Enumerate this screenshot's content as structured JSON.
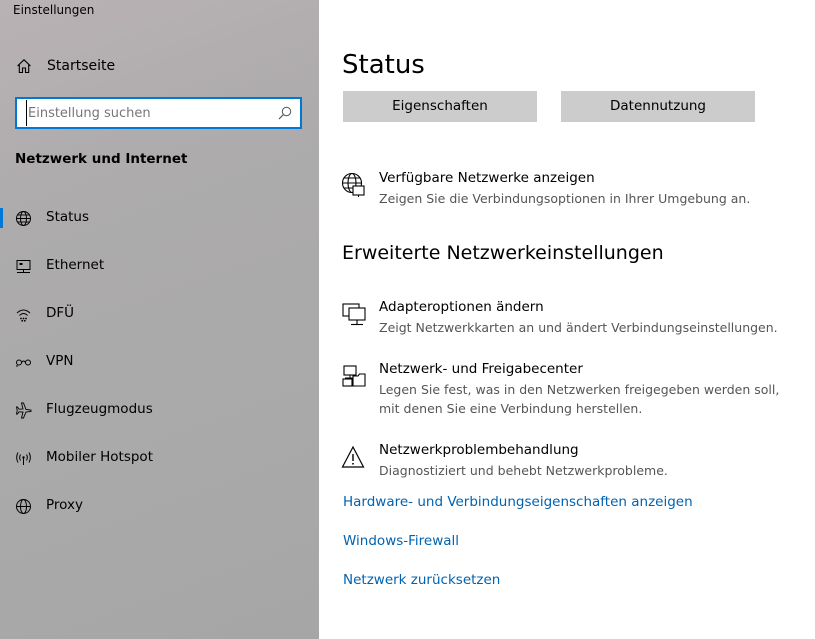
{
  "window": {
    "title": "Einstellungen"
  },
  "sidebar": {
    "home": {
      "label": "Startseite",
      "icon": "home-icon"
    },
    "search": {
      "placeholder": "Einstellung suchen",
      "value": "",
      "icon": "search-icon"
    },
    "section_title": "Netzwerk und Internet",
    "items": [
      {
        "id": "status",
        "label": "Status",
        "icon": "globe-icon",
        "selected": true
      },
      {
        "id": "ethernet",
        "label": "Ethernet",
        "icon": "ethernet-icon",
        "selected": false
      },
      {
        "id": "dfu",
        "label": "DFÜ",
        "icon": "dialup-icon",
        "selected": false
      },
      {
        "id": "vpn",
        "label": "VPN",
        "icon": "vpn-icon",
        "selected": false
      },
      {
        "id": "flugzeugmodus",
        "label": "Flugzeugmodus",
        "icon": "airplane-icon",
        "selected": false
      },
      {
        "id": "hotspot",
        "label": "Mobiler Hotspot",
        "icon": "hotspot-icon",
        "selected": false
      },
      {
        "id": "proxy",
        "label": "Proxy",
        "icon": "globe-icon",
        "selected": false
      }
    ],
    "accent_color": "#0078d7"
  },
  "main": {
    "title": "Status",
    "buttons": {
      "properties": "Eigenschaften",
      "data_usage": "Datennutzung"
    },
    "available_networks": {
      "title": "Verfügbare Netzwerke anzeigen",
      "desc": "Zeigen Sie die Verbindungsoptionen in Ihrer Umgebung an."
    },
    "advanced_title": "Erweiterte Netzwerkeinstellungen",
    "advanced": [
      {
        "title": "Adapteroptionen ändern",
        "desc": "Zeigt Netzwerkkarten an und ändert Verbindungseinstellungen.",
        "icon": "network-adapter-icon"
      },
      {
        "title": "Netzwerk- und Freigabecenter",
        "desc": "Legen Sie fest, was in den Netzwerken freigegeben werden soll, mit denen Sie eine Verbindung herstellen.",
        "icon": "sharing-center-icon"
      },
      {
        "title": "Netzwerkproblembehandlung",
        "desc": "Diagnostiziert und behebt Netzwerkprobleme.",
        "icon": "warning-icon"
      }
    ],
    "links": [
      "Hardware- und Verbindungseigenschaften anzeigen",
      "Windows-Firewall",
      "Netzwerk zurücksetzen"
    ],
    "link_color": "#0063b1"
  }
}
